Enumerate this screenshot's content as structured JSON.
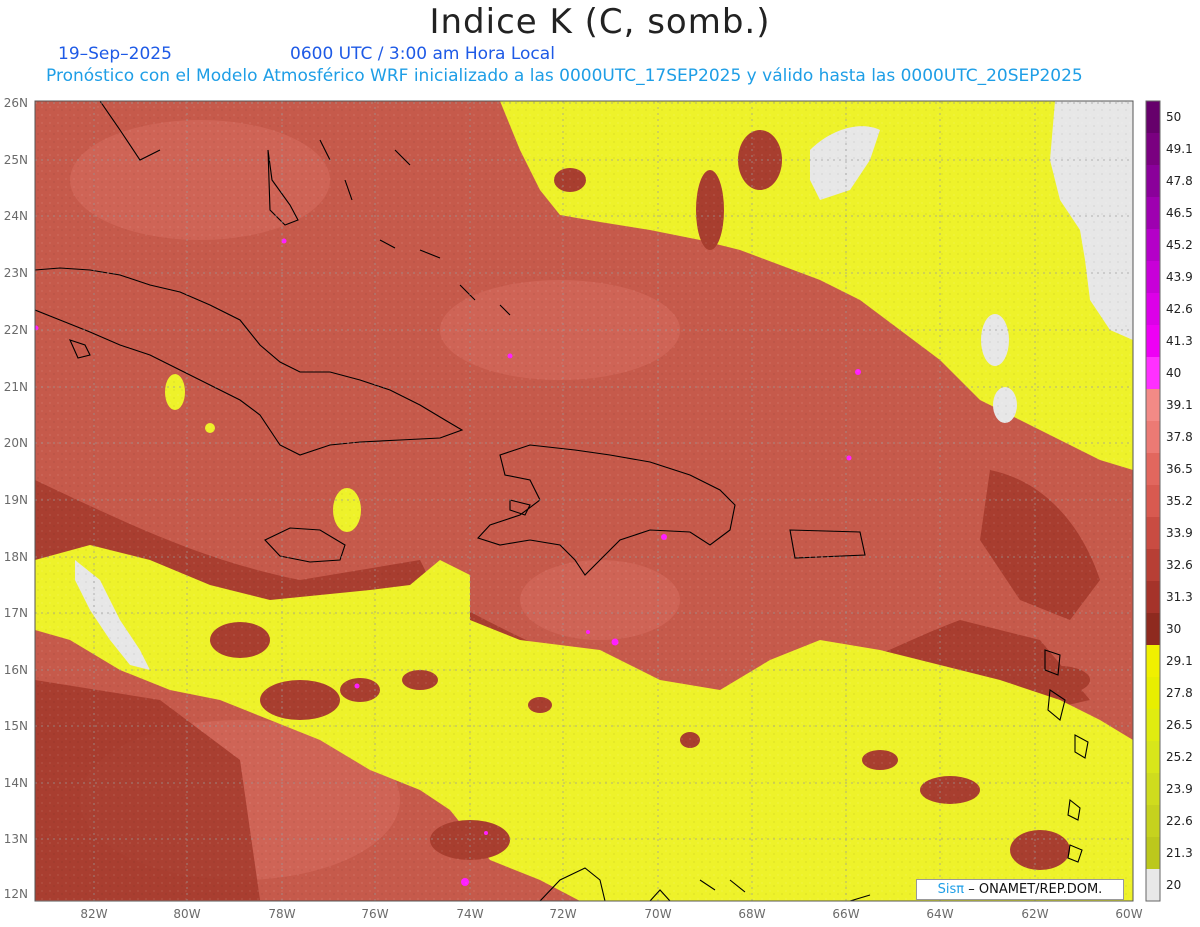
{
  "title": "Indice K (C, somb.)",
  "date": "19–Sep–2025",
  "time": "0600 UTC / 3:00 am Hora Local",
  "subtitle": "Pronóstico con el Modelo Atmosférico WRF inicializado a las 0000UTC_17SEP2025 y válido hasta las  0000UTC_20SEP2025",
  "credit": {
    "brand": "Sisπ",
    "text": "–  ONAMET/REP.DOM."
  },
  "axes": {
    "lat_labels": [
      "26N",
      "25N",
      "24N",
      "23N",
      "22N",
      "21N",
      "20N",
      "19N",
      "18N",
      "17N",
      "16N",
      "15N",
      "14N",
      "13N",
      "12N"
    ],
    "lon_labels": [
      "82W",
      "80W",
      "78W",
      "76W",
      "74W",
      "72W",
      "70W",
      "68W",
      "66W",
      "64W",
      "62W",
      "60W"
    ]
  },
  "legend": {
    "values": [
      "50",
      "49.1",
      "47.8",
      "46.5",
      "45.2",
      "43.9",
      "42.6",
      "41.3",
      "40",
      "39.1",
      "37.8",
      "36.5",
      "35.2",
      "33.9",
      "32.6",
      "31.3",
      "30",
      "29.1",
      "27.8",
      "26.5",
      "25.2",
      "23.9",
      "22.6",
      "21.3",
      "20"
    ],
    "colors": [
      "#66006b",
      "#7a0080",
      "#8a009a",
      "#9e00b0",
      "#b400c8",
      "#c800d8",
      "#dc00e8",
      "#ee00f4",
      "#ff30ff",
      "#f38a86",
      "#ec7a74",
      "#e2675e",
      "#d85a50",
      "#c94c42",
      "#b73f35",
      "#a5332a",
      "#8e2a1f",
      "#f0f000",
      "#e8ee00",
      "#e0ec10",
      "#d8e61a",
      "#cfdc1e",
      "#c6d21e",
      "#bcc81c",
      "#e8e8e8"
    ]
  },
  "colors": {
    "high_k": "#c75a4c",
    "mid_k": "#a8402f",
    "low_k": "#eef230",
    "no_data": "#e6e6e6",
    "coastline": "#000000"
  }
}
